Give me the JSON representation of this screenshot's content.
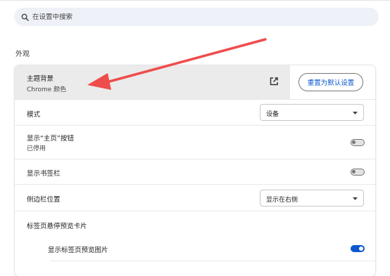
{
  "search": {
    "placeholder": "在设置中搜索"
  },
  "section": {
    "title": "外观"
  },
  "theme": {
    "label": "主题背景",
    "value": "Chrome 颜色",
    "reset_label": "重置为默认设置"
  },
  "mode": {
    "label": "模式",
    "selected": "设备"
  },
  "home_button": {
    "label": "显示“主页”按钮",
    "status": "已停用",
    "enabled": false
  },
  "bookmarks_bar": {
    "label": "显示书签栏",
    "enabled": false
  },
  "side_panel": {
    "label": "侧边栏位置",
    "selected": "显示在右侧"
  },
  "tab_hover": {
    "label": "标签页悬停预览卡片",
    "preview_images": {
      "label": "显示标签页预览图片",
      "enabled": true
    }
  },
  "annotation": {
    "arrow_color": "#ef4c4c"
  },
  "colors": {
    "accent": "#0b57d0",
    "search_bg": "#eef1f7",
    "highlight_bg": "#ebebeb"
  }
}
